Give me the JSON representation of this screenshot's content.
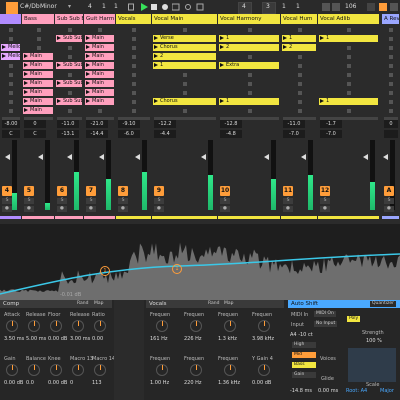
{
  "transport": {
    "key": "C#/Db",
    "scale": "Minor",
    "bar": "4",
    "beat": "1",
    "sixteenth": "1",
    "loop_start": "4",
    "loop_len": "3",
    "beat2": "1",
    "beat3": "1",
    "zoom": "106"
  },
  "tracks": [
    {
      "name": "",
      "color": "#b18cff",
      "volume": "-8.00",
      "pan": "C",
      "num": "4",
      "meter": 0.25
    },
    {
      "name": "Bass",
      "color": "#ff9fbd",
      "volume": "0",
      "pan": "C",
      "num": "5",
      "meter": 0.1
    },
    {
      "name": "Sub Sub Bass",
      "color": "#ff9fbd",
      "volume": "-11.0",
      "pan": "-13.1",
      "num": "6",
      "meter": 0.55
    },
    {
      "name": "Guit Harm",
      "color": "#ff9fbd",
      "volume": "-21.0",
      "pan": "-14.4",
      "num": "7",
      "meter": 0.45
    },
    {
      "name": "Vocals",
      "color": "#f2e640",
      "volume": "-9.10",
      "pan": "-6.0",
      "num": "8",
      "meter": 0.55
    },
    {
      "name": "Vocal Main",
      "color": "#f2e640",
      "volume": "-12.2",
      "pan": "-4.4",
      "num": "9",
      "meter": 0.5
    },
    {
      "name": "Vocal Harmony",
      "color": "#f2e640",
      "volume": "-12.8",
      "pan": "-4.8",
      "num": "10",
      "meter": 0.45
    },
    {
      "name": "Vocal Hum",
      "color": "#f2e640",
      "volume": "-11.0",
      "pan": "-7.0",
      "num": "11",
      "meter": 0.5
    },
    {
      "name": "Vocal Adlib",
      "color": "#f2e640",
      "volume": "-1.7",
      "pan": "-7.0",
      "num": "12",
      "meter": 0.4
    },
    {
      "name": "A Reverb",
      "color": "#9aa6ff",
      "volume": "0",
      "pan": "",
      "num": "A",
      "meter": 0.0
    }
  ],
  "clips": {
    "col0": [
      "Mello",
      "Mello"
    ],
    "col1": [
      "Main",
      "Main",
      "Main",
      "Main",
      "Main",
      "Main",
      "Main"
    ],
    "col2": [
      "Sub Sub Ba",
      "Sub Sub Ba",
      "Sub Sub Ba",
      "Sub Sub Ba"
    ],
    "col3": [
      "Main",
      "Main",
      "Main",
      "Main",
      "Main",
      "Main",
      "Main",
      "Main"
    ],
    "vocal_main": [
      "Verse",
      "Chorus",
      "2",
      "1",
      "Chorus"
    ],
    "vocal_harmony": [
      "1",
      "2",
      "Extra",
      "1"
    ],
    "vocal_hum": [
      "1",
      "2"
    ],
    "vocal_adlib": [
      "1",
      "1"
    ]
  },
  "numbers": {
    "wave_marker": "1",
    "wave_marker2": "1",
    "wave_value": "-0.01 dB"
  },
  "device1": {
    "title": "Comp",
    "knobs": [
      {
        "label": "Attack",
        "value": "3.50 ms"
      },
      {
        "label": "Release",
        "value": "5.00 ms"
      },
      {
        "label": "Floor",
        "value": "0.00 dB"
      },
      {
        "label": "Release",
        "value": "3.00 ms"
      },
      {
        "label": "Ratio",
        "value": "0.00"
      }
    ],
    "knobs2": [
      {
        "label": "Gain",
        "value": "0.00 dB"
      },
      {
        "label": "Balance",
        "value": "0.0"
      },
      {
        "label": "Knee",
        "value": "0.00 dB"
      },
      {
        "label": "Macro 13",
        "value": "0"
      },
      {
        "label": "Macro 14",
        "value": "113"
      }
    ],
    "rand": "Rand",
    "map": "Map"
  },
  "device2": {
    "title": "Vocals",
    "rand": "Rand",
    "map": "Map",
    "bands": [
      {
        "label": "Frequen",
        "value": "161 Hz"
      },
      {
        "label": "Frequen",
        "value": "226 Hz"
      },
      {
        "label": "Frequen",
        "value": "1.3 kHz"
      },
      {
        "label": "Frequen",
        "value": "3.98 kHz"
      }
    ],
    "bands2": [
      {
        "label": "Frequen",
        "value": "1.00 Hz"
      },
      {
        "label": "Frequen",
        "value": "220 Hz"
      },
      {
        "label": "Frequen",
        "value": "1.36 kHz"
      },
      {
        "label": "Y Gain 4",
        "value": "0.00 dB"
      }
    ]
  },
  "device3": {
    "title": "Auto Shift",
    "input": "Input",
    "midi_in": "MIDI In",
    "midi_on": "MIDI On",
    "no_input": "No Input",
    "options": [
      "High",
      "Mid",
      "Bass",
      "Gain"
    ],
    "rate": "A4 -10 ct",
    "pitch_val": "-14.8 ms",
    "voices": "Voices",
    "glide": "Glide",
    "glide_val": "0.00 ms",
    "strength": "Strength",
    "strength_val": "100 %",
    "root_key": "Root: A4",
    "scale": "Scale",
    "scale_val": "Major",
    "follow": "Poly",
    "tab": "Quantizer"
  }
}
